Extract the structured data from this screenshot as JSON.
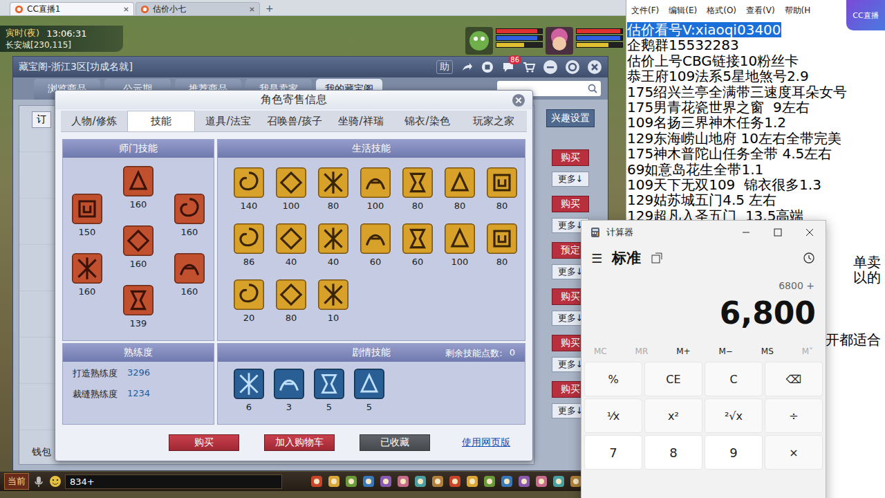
{
  "browser": {
    "tabs": [
      {
        "label": "CC直播1",
        "selected": true
      },
      {
        "label": "估价小七",
        "selected": false
      }
    ],
    "new_tab": "+"
  },
  "hud": {
    "period": "寅时(夜)",
    "clock": "13:06:31",
    "location": "长安城[230,115]",
    "player_bars": [
      {
        "color": "#e03030",
        "level": 0.95
      },
      {
        "color": "#3060e0",
        "level": 0.95
      },
      {
        "color": "#e0c030",
        "level": 0.7
      }
    ],
    "pet_bars": [
      {
        "color": "#e03030",
        "level": 0.9
      },
      {
        "color": "#3060e0",
        "level": 0.9
      },
      {
        "color": "#e0c030",
        "level": 0.6
      }
    ]
  },
  "cbg": {
    "title": "藏宝阁-浙江3区[功成名就]",
    "help": "助",
    "badge": "86",
    "nav": [
      {
        "label": "浏览商品",
        "selected": false
      },
      {
        "label": "公示期",
        "selected": false
      },
      {
        "label": "推荐商品",
        "selected": false
      },
      {
        "label": "我是卖家",
        "selected": false
      },
      {
        "label": "我的藏宝阁",
        "selected": true
      }
    ],
    "filter": "订",
    "interest": "兴趣设置",
    "rows": [
      {
        "action": "购买",
        "more": "更多↓"
      },
      {
        "action": "购买",
        "more": "更多↓"
      },
      {
        "action": "预定",
        "more": "更多↓"
      },
      {
        "action": "购买",
        "more": "更多↓"
      },
      {
        "action": "购买",
        "more": "更多↓"
      },
      {
        "action": "购买",
        "more": "更多↓"
      }
    ],
    "wallet": "钱包"
  },
  "dialog": {
    "title": "角色寄售信息",
    "tabs": [
      {
        "label": "人物/修炼",
        "selected": false
      },
      {
        "label": "技能",
        "selected": true
      },
      {
        "label": "道具/法宝",
        "selected": false
      },
      {
        "label": "召唤兽/孩子",
        "selected": false
      },
      {
        "label": "坐骑/祥瑞",
        "selected": false
      },
      {
        "label": "锦衣/染色",
        "selected": false
      },
      {
        "label": "玩家之家",
        "selected": false
      }
    ],
    "school": {
      "title": "师门技能",
      "skills": [
        "160",
        "150",
        "160",
        "160",
        "160",
        "160",
        "139"
      ]
    },
    "life": {
      "title": "生活技能",
      "skills": [
        "140",
        "100",
        "80",
        "100",
        "80",
        "80",
        "80",
        "86",
        "40",
        "40",
        "60",
        "60",
        "100",
        "80",
        "20",
        "80",
        "10"
      ]
    },
    "proficiency": {
      "title": "熟练度",
      "items": [
        {
          "label": "打造熟练度",
          "value": "3296"
        },
        {
          "label": "裁缝熟练度",
          "value": "1234"
        }
      ]
    },
    "story": {
      "title": "剧情技能",
      "points_label": "剩余技能点数:",
      "points": "0",
      "skills": [
        "6",
        "3",
        "5",
        "5"
      ]
    },
    "buttons": [
      {
        "label": "购买",
        "kind": "primary"
      },
      {
        "label": "加入购物车",
        "kind": "primary"
      },
      {
        "label": "已收藏",
        "kind": "muted"
      }
    ],
    "web_link": "使用网页版"
  },
  "chat_bar": {
    "channel": "当前",
    "input": "834+"
  },
  "notepad": {
    "menu": [
      "文件(F)",
      "编辑(E)",
      "格式(O)",
      "查看(V)",
      "帮助(H"
    ],
    "watermark": "CC直播",
    "lines": [
      {
        "text": "估价看号V:xiaoqi03400",
        "selected": true,
        "kind": "full"
      },
      {
        "text": "企鹅群15532283",
        "selected": false,
        "kind": "full"
      },
      {
        "text": "估价上号CBG链接10粉丝卡",
        "selected": false,
        "kind": "full"
      },
      {
        "text": "恭王府109法系5星地煞号2.9",
        "selected": false,
        "kind": "full"
      },
      {
        "text": "175绍兴兰亭全满带三速度耳朵女号",
        "selected": false,
        "kind": "full"
      },
      {
        "text": "175男青花瓷世界之窗  9左右",
        "selected": false,
        "kind": "full"
      },
      {
        "text": "109名扬三界神木任务1.2",
        "selected": false,
        "kind": "full"
      },
      {
        "text": "129东海崂山地府 10左右全带完美",
        "selected": false,
        "kind": "full"
      },
      {
        "text": "175神木普陀山任务全带 4.5左右",
        "selected": false,
        "kind": "full"
      },
      {
        "text": "69如意岛花生全带1.1",
        "selected": false,
        "kind": "full"
      },
      {
        "text": "109天下无双109  锦衣很多1.3",
        "selected": false,
        "kind": "full"
      },
      {
        "text": "129姑苏城五门4.5 左右",
        "selected": false,
        "kind": "full"
      },
      {
        "text": "129超凡入圣五门  13.5高端",
        "selected": false,
        "kind": "full"
      },
      {
        "text": "",
        "selected": false,
        "kind": "tail"
      },
      {
        "text": "",
        "selected": false,
        "kind": "tail"
      },
      {
        "text": "单卖",
        "selected": false,
        "kind": "tail"
      },
      {
        "text": "以的",
        "selected": false,
        "kind": "tail"
      },
      {
        "text": "",
        "selected": false,
        "kind": "tail"
      },
      {
        "text": "",
        "selected": false,
        "kind": "tail"
      },
      {
        "text": "",
        "selected": false,
        "kind": "tail"
      },
      {
        "text": "开都适合",
        "selected": false,
        "kind": "tail"
      }
    ]
  },
  "calculator": {
    "title": "计算器",
    "menu": "☰",
    "mode": "标准",
    "expression": "6800 +",
    "display": "6,800",
    "memory": [
      {
        "label": "MC",
        "disabled": true
      },
      {
        "label": "MR",
        "disabled": true
      },
      {
        "label": "M+",
        "disabled": false
      },
      {
        "label": "M−",
        "disabled": false
      },
      {
        "label": "MS",
        "disabled": false
      },
      {
        "label": "M˅",
        "disabled": true
      }
    ],
    "keys": [
      {
        "label": "%",
        "kind": "op"
      },
      {
        "label": "CE",
        "kind": "op"
      },
      {
        "label": "C",
        "kind": "op"
      },
      {
        "label": "⌫",
        "kind": "op"
      },
      {
        "label": "¹⁄x",
        "kind": "op"
      },
      {
        "label": "x²",
        "kind": "op"
      },
      {
        "label": "²√x",
        "kind": "op"
      },
      {
        "label": "÷",
        "kind": "op"
      },
      {
        "label": "7",
        "kind": "digit"
      },
      {
        "label": "8",
        "kind": "digit"
      },
      {
        "label": "9",
        "kind": "digit"
      },
      {
        "label": "×",
        "kind": "op"
      }
    ]
  }
}
